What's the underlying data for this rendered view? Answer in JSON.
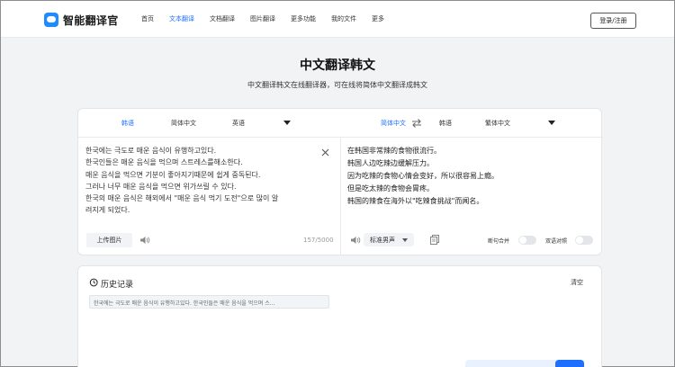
{
  "header": {
    "logo_text": "智能翻译官",
    "nav": [
      "首页",
      "文本翻译",
      "文档翻译",
      "图片翻译",
      "更多功能",
      "我的文件",
      "更多"
    ],
    "active_nav_index": 1,
    "login_label": "登录/注册",
    "accent": "#1f6fff"
  },
  "page": {
    "title": "中文翻译韩文",
    "subtitle": "中文翻译韩文在线翻译器，可在线将简体中文翻译成韩文"
  },
  "translator": {
    "source_langs": [
      "韩语",
      "简体中文",
      "英语"
    ],
    "source_active_index": 0,
    "target_langs": [
      "简体中文",
      "韩语",
      "繁体中文"
    ],
    "target_active_index": 0,
    "source_lines": [
      "한국에는 극도로 매운 음식이 유행하고있다.",
      "한국인들은 매운 음식을 먹으며 스트레스를해소한다.",
      "매운 음식을 먹으면 기분이 좋아지기때문에 쉽게 중독된다.",
      "그러나 너무 매운 음식을 먹으면 위가쓰릴 수 있다.",
      "한국의 매운 음식은 해외에서 \"매운 음식 먹기 도전\"으로 많이 알",
      "려지게 되었다."
    ],
    "target_lines": [
      "在韩国非常辣的食物很流行。",
      "韩国人边吃辣边缓解压力。",
      "因为吃辣的食物心情会变好，所以很容易上瘾。",
      "但是吃太辣的食物会胃疼。",
      "韩国的辣食在海外以\"吃辣食挑战\"而闻名。"
    ],
    "upload_label": "上传图片",
    "char_count": "157/5000",
    "voice_label": "标准男声",
    "toggle_split": "断句合并",
    "toggle_bilingual": "双语对照"
  },
  "history": {
    "title": "历史记录",
    "clear_label": "清空",
    "items": [
      "한국에는 극도로 매운 음식이 유행하고있다. 한국인들은 매운 음식을 먹으며 스..."
    ]
  }
}
